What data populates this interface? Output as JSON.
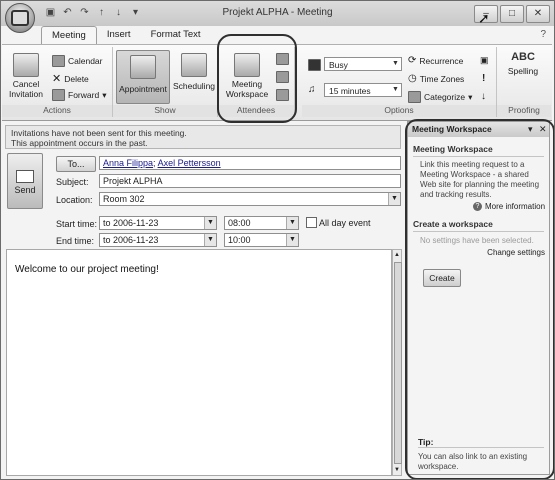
{
  "window": {
    "title": "Projekt ALPHA - Meeting"
  },
  "ribbon_tabs": [
    "Meeting",
    "Insert",
    "Format Text"
  ],
  "groups": {
    "actions": {
      "label": "Actions",
      "cancel_line1": "Cancel",
      "cancel_line2": "Invitation",
      "calendar": "Calendar",
      "delete": "Delete",
      "forward": "Forward"
    },
    "show": {
      "label": "Show",
      "appointment": "Appointment",
      "scheduling": "Scheduling"
    },
    "attendees": {
      "label": "Attendees",
      "meeting_line1": "Meeting",
      "meeting_line2": "Workspace"
    },
    "options": {
      "label": "Options",
      "busy": "Busy",
      "reminder": "15 minutes",
      "recurrence": "Recurrence",
      "time_zones": "Time Zones",
      "categorize": "Categorize"
    },
    "proofing": {
      "label": "Proofing",
      "spelling": "Spelling"
    }
  },
  "infobar": {
    "line1": "Invitations have not been sent for this meeting.",
    "line2": "This appointment occurs in the past."
  },
  "form": {
    "send": "Send",
    "to_button": "To...",
    "to_names": [
      "Anna Filippa",
      "Axel Pettersson"
    ],
    "subject_label": "Subject:",
    "subject": "Projekt ALPHA",
    "location_label": "Location:",
    "location": "Room 302",
    "start_label": "Start time:",
    "start_date": "to 2006-11-23",
    "start_time": "08:00",
    "end_label": "End time:",
    "end_date": "to 2006-11-23",
    "end_time": "10:00",
    "all_day": "All day event"
  },
  "body_text": "Welcome to our project meeting!",
  "pane": {
    "title": "Meeting Workspace",
    "section1": "Meeting Workspace",
    "desc": "Link this meeting request to a Meeting Workspace - a shared Web site for planning the meeting and tracking results.",
    "more_info": "More information",
    "section2": "Create a workspace",
    "no_settings": "No settings have been selected.",
    "change_settings": "Change settings",
    "create": "Create",
    "tip_label": "Tip:",
    "tip_text": "You can also link to an existing workspace."
  },
  "icons": [
    "office-button-icon",
    "save-icon",
    "undo-icon",
    "redo-icon",
    "up-icon",
    "down-icon",
    "customize-icon",
    "minimize-icon",
    "maximize-icon",
    "close-icon",
    "help-icon",
    "calendar-icon",
    "delete-icon",
    "forward-icon",
    "appointment-icon",
    "scheduling-icon",
    "meeting-workspace-icon",
    "address-book-icon",
    "check-names-icon",
    "response-options-icon",
    "busy-color-icon",
    "bell-icon",
    "recurrence-icon",
    "time-zones-icon",
    "categorize-icon",
    "importance-high-icon",
    "importance-low-icon",
    "private-icon",
    "spelling-icon",
    "send-icon",
    "help-circle-icon"
  ]
}
